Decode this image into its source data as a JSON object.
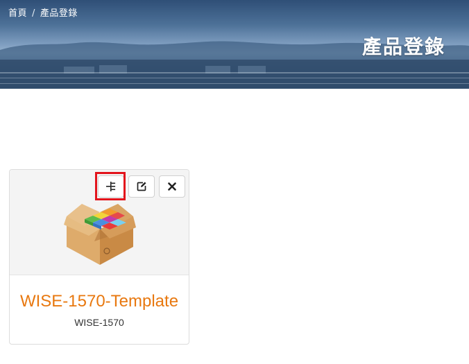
{
  "breadcrumb": {
    "home": "首頁",
    "separator": "/",
    "current": "產品登錄"
  },
  "header": {
    "title": "產品登錄"
  },
  "card": {
    "name": "WISE-1570-Template",
    "model": "WISE-1570",
    "actions": [
      {
        "icon": "tree-structure-icon",
        "highlighted": true
      },
      {
        "icon": "edit-icon"
      },
      {
        "icon": "close-icon"
      }
    ],
    "image": "product-box-icon"
  },
  "colors": {
    "accent": "#e8780f",
    "highlight": "#e3141c"
  }
}
